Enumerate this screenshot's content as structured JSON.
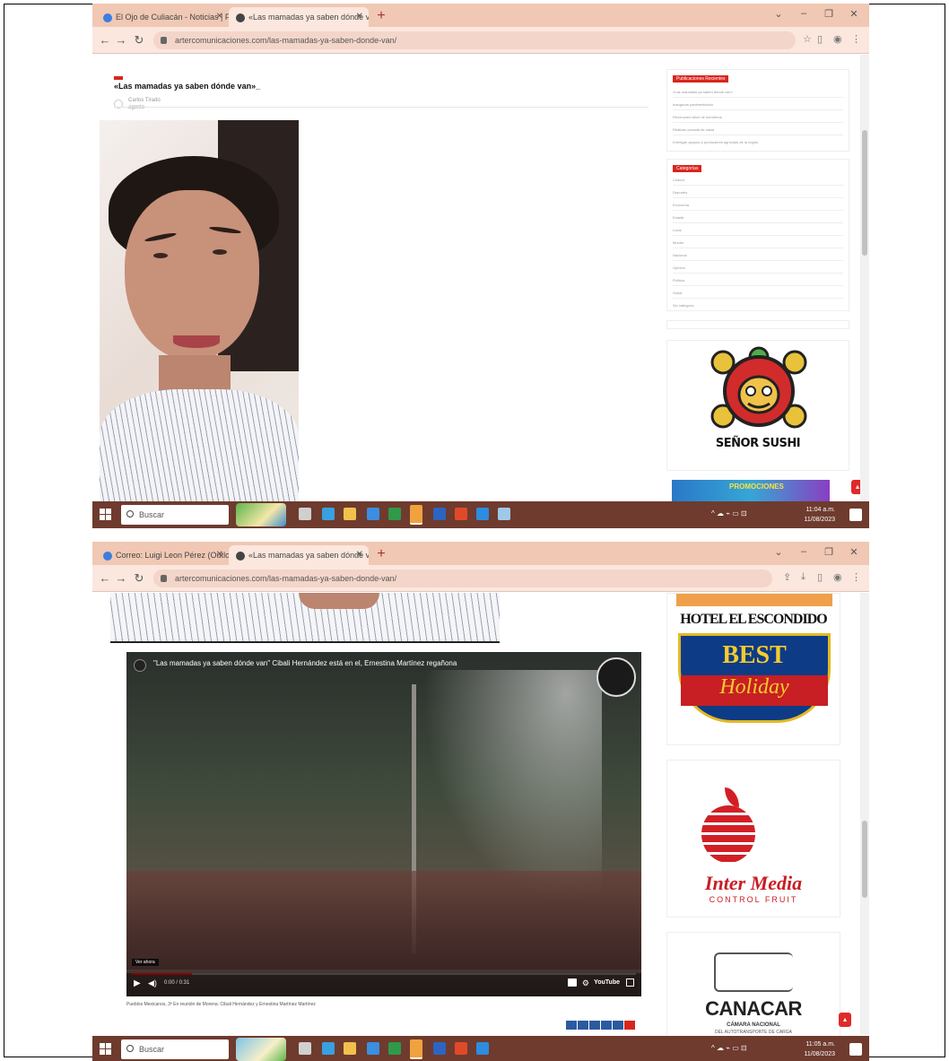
{
  "shot1": {
    "tabs": [
      {
        "label": "El Ojo de Culiacán - Noticias | Facebook",
        "active": false
      },
      {
        "label": "«Las mamadas ya saben dónde van»",
        "active": true
      }
    ],
    "url": "artercomunicaciones.com/las-mamadas-ya-saben-donde-van/",
    "post": {
      "title": "«Las mamadas ya saben dónde van»_",
      "author": "Carlos Tirado",
      "date": "agosto"
    },
    "sidebar": {
      "recent_tag": "Publicaciones Recientes",
      "recent_items": [
        "«Las mamadas ya saben dónde van»",
        "Inauguran pavimentación",
        "Reconocen labor de bomberos",
        "Realizan jornada de salud",
        "Entregan apoyos a productores agrícolas de la región"
      ],
      "categories_tag": "Categorías",
      "category_items": [
        "Cultura",
        "Deportes",
        "Economía",
        "Estatal",
        "Local",
        "Mundo",
        "Nacional",
        "Opinión",
        "Política",
        "Salud",
        "Sin categoría"
      ]
    },
    "ads": {
      "sushi": "SEÑOR SUSHI",
      "banner": "PROMOCIONES"
    },
    "taskbar": {
      "search": "Buscar",
      "time": "11:04 a.m.",
      "date": "11/08/2023"
    }
  },
  "shot2": {
    "tabs": [
      {
        "label": "Correo: Luigi Leon Pérez (Outlook)",
        "active": false
      },
      {
        "label": "«Las mamadas ya saben dónde van»",
        "active": true
      }
    ],
    "url": "artercomunicaciones.com/las-mamadas-ya-saben-donde-van/",
    "video": {
      "title": "\"Las mamadas ya saben dónde van\" Cibali Hernández está en el, Ernestina Martínez regañona",
      "time": "0:00 / 0:31",
      "watch_later": "Ver ahora",
      "logo": "YouTube",
      "progress": 0.12
    },
    "caption": "Pueblos Mexicanos, 3ª En reunión de Morena: Cibali Hernández y Ernestina Martínez Martínez",
    "ads": {
      "hotel": "HOTEL EL ESCONDIDO",
      "best_line1": "BEST",
      "best_line2": "Holiday",
      "inter_title": "Inter Media",
      "inter_sub": "CONTROL FRUIT",
      "canacar_title": "CANACAR",
      "canacar_sub": "CÁMARA NACIONAL",
      "canacar_sub2": "DEL AUTOTRANSPORTE DE CARGA"
    },
    "taskbar": {
      "search": "Buscar",
      "time": "11:05 a.m.",
      "date": "11/08/2023"
    }
  },
  "colors": {
    "accent": "#d9251d",
    "tabbar": "#f0c8b4",
    "taskbar": "#6e3b2e"
  }
}
